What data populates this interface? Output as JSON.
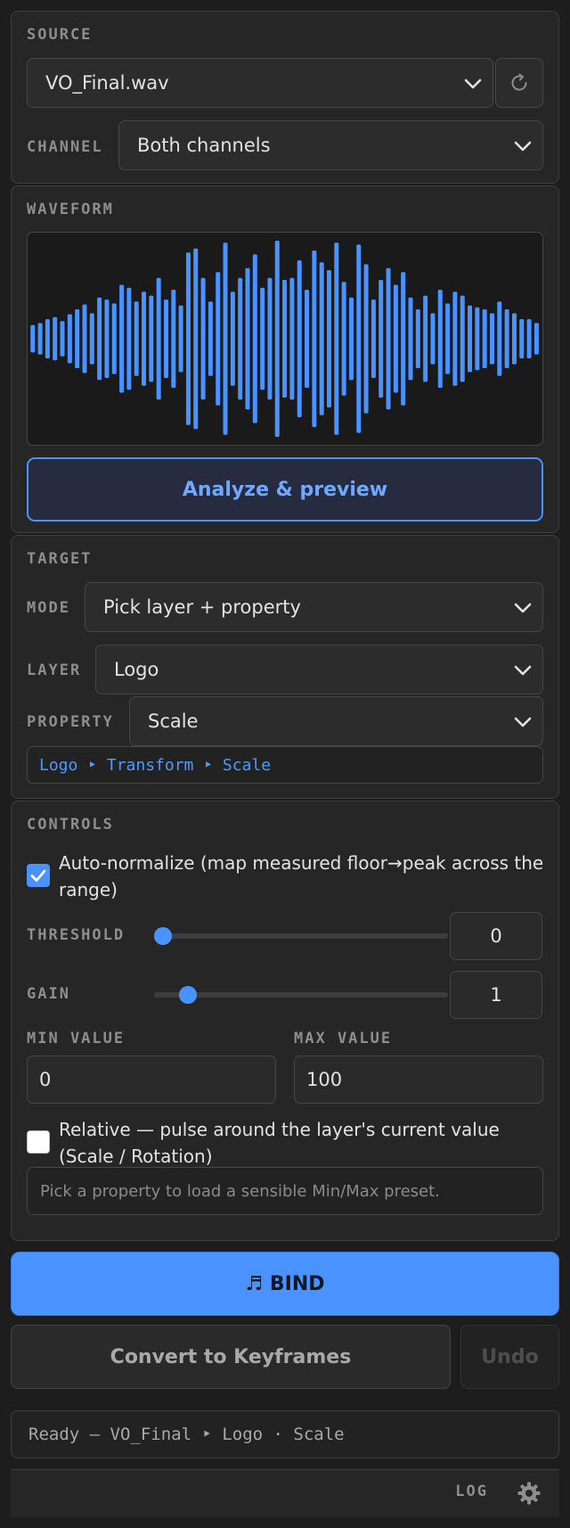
{
  "source": {
    "title": "SOURCE",
    "file": "VO_Final.wav",
    "refresh_icon": "refresh-icon",
    "channel_label": "CHANNEL",
    "channel_value": "Both channels"
  },
  "waveform": {
    "title": "WAVEFORM",
    "analyze_label": "Analyze & preview",
    "bar_color": "#4a93ff",
    "bars": [
      0.14,
      0.16,
      0.2,
      0.22,
      0.18,
      0.25,
      0.3,
      0.35,
      0.26,
      0.42,
      0.4,
      0.36,
      0.55,
      0.52,
      0.38,
      0.48,
      0.44,
      0.62,
      0.4,
      0.5,
      0.34,
      0.88,
      0.92,
      0.62,
      0.38,
      0.68,
      0.98,
      0.48,
      0.62,
      0.72,
      0.86,
      0.52,
      0.62,
      1.0,
      0.6,
      0.62,
      0.8,
      0.5,
      0.9,
      0.78,
      0.7,
      0.98,
      0.58,
      0.42,
      0.96,
      0.76,
      0.4,
      0.6,
      0.72,
      0.55,
      0.68,
      0.42,
      0.3,
      0.44,
      0.26,
      0.5,
      0.36,
      0.48,
      0.44,
      0.34,
      0.32,
      0.3,
      0.26,
      0.38,
      0.3,
      0.26,
      0.2,
      0.2,
      0.16
    ]
  },
  "target": {
    "title": "TARGET",
    "mode_label": "MODE",
    "mode_value": "Pick layer + property",
    "layer_label": "LAYER",
    "layer_value": "Logo",
    "property_label": "PROPERTY",
    "property_value": "Scale",
    "path": "Logo ‣ Transform ‣ Scale"
  },
  "controls": {
    "title": "CONTROLS",
    "auto_normalize_label": "Auto-normalize (map measured floor→peak across the range)",
    "auto_normalize_checked": true,
    "threshold_label": "THRESHOLD",
    "threshold_value": "0",
    "threshold_fraction": 0.0,
    "gain_label": "GAIN",
    "gain_value": "1",
    "gain_fraction": 0.09,
    "min_label": "MIN VALUE",
    "min_value": "0",
    "max_label": "MAX VALUE",
    "max_value": "100",
    "relative_label": "Relative — pulse around the layer's current value (Scale / Rotation)",
    "relative_checked": false,
    "hint": "Pick a property to load a sensible Min/Max preset."
  },
  "actions": {
    "bind_label": "♬ BIND",
    "convert_label": "Convert to Keyframes",
    "undo_label": "Undo"
  },
  "status": "Ready — VO_Final ‣ Logo · Scale",
  "footer": {
    "log_label": "LOG",
    "settings_icon": "gear-icon"
  },
  "colors": {
    "accent": "#4a93ff",
    "background": "#1d1d1d",
    "panel": "#262626"
  }
}
